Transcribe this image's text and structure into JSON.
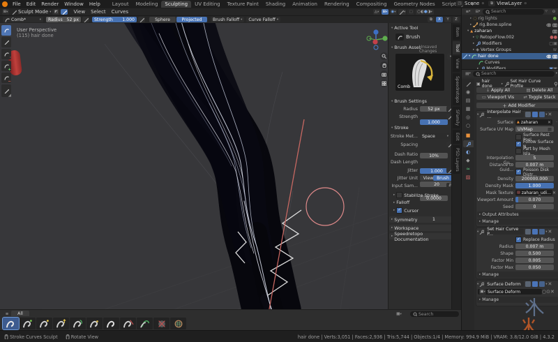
{
  "topbar": {
    "menus": [
      "File",
      "Edit",
      "Render",
      "Window",
      "Help"
    ],
    "workspaces": [
      "Layout",
      "Modeling",
      "Sculpting",
      "UV Editing",
      "Texture Paint",
      "Shading",
      "Animation",
      "Rendering",
      "Compositing",
      "Geometry Nodes",
      "Scripting"
    ],
    "active_workspace": "Sculpting",
    "new_workspace": "+",
    "scene": "Scene",
    "viewlayer": "ViewLayer"
  },
  "viewport_header": {
    "mode": "Sculpt Mode",
    "menus": [
      "View",
      "Select",
      "Curves"
    ]
  },
  "brush_header": {
    "brush": "Comb*",
    "radius_label": "Radius",
    "radius": "52 px",
    "strength_label": "Strength",
    "strength": "1.000",
    "sphere": "Sphere",
    "projected": "Projected",
    "brush_falloff": "Brush Falloff",
    "curve_falloff": "Curve Falloff",
    "mirror": [
      "X",
      "Y",
      "Z"
    ]
  },
  "viewport": {
    "overlay_line1": "User Perspective",
    "overlay_line2": "(115) hair done"
  },
  "npanel": {
    "tabs": [
      "Item",
      "Tool",
      "View",
      "Speedretopo",
      "SFamily",
      "Edit",
      "PSD Layers"
    ],
    "active_tab": "Tool",
    "active_tool_header": "Active Tool",
    "brush_name": "Brush",
    "brush_asset_header": "Brush Asset",
    "brush_asset_status": "Unsaved Changes",
    "preview_name": "Comb",
    "brush_settings_header": "Brush Settings",
    "radius_label": "Radius",
    "radius": "52 px",
    "strength_label": "Strength",
    "strength": "1.000",
    "stroke_header": "Stroke",
    "stroke_method_label": "Stroke Met...",
    "stroke_method": "Space",
    "spacing_label": "Spacing",
    "spacing": "10%",
    "dash_ratio_label": "Dash Ratio",
    "dash_ratio": "1.000",
    "dash_length_label": "Dash Length",
    "dash_length": "20",
    "jitter_label": "Jitter",
    "jitter": "0.0000",
    "jitter_unit_label": "Jitter Unit",
    "jitter_view": "View",
    "jitter_brush": "Brush",
    "input_samples_label": "Input Sam...",
    "input_samples": "1",
    "stabilize": "Stabilize Stroke",
    "falloff": "Falloff",
    "cursor": "Cursor",
    "sections": [
      "Symmetry",
      "Workspace",
      "Speedretopo Documentation"
    ]
  },
  "outliner": {
    "search_placeholder": "Search",
    "rows": [
      {
        "label": "rig lights"
      },
      {
        "label": "rig.Bone.spline"
      },
      {
        "label": "zaharan"
      },
      {
        "label": "RetopoFlow.002"
      },
      {
        "label": "Modifiers"
      },
      {
        "label": "Vertex Groups"
      },
      {
        "label": "hair done"
      },
      {
        "label": "Curves"
      },
      {
        "label": "Modifiers"
      }
    ]
  },
  "properties": {
    "search_placeholder": "Search",
    "breadcrumb_object": "hair done",
    "breadcrumb_modifier": "Set Hair Curve Profile",
    "tool_buttons": [
      "Apply All",
      "Delete All",
      "Viewport Vis",
      "Toggle Stack"
    ],
    "add_modifier": "Add Modifier",
    "mod1": {
      "title": "Interpolate Hair ...",
      "surface_label": "Surface",
      "surface": "zaharan",
      "uv_label": "Surface UV Map",
      "uv": "UVMap",
      "rest": "Surface Rest Posi...",
      "follow": "Follow Surface N...",
      "part": "Part by Mesh Isla...",
      "interp_label": "Interpolation Gu...",
      "interp": "5",
      "dist_label": "Distance to Guid...",
      "dist": "0.007 m",
      "poisson": "Poisson Disk Distr...",
      "density_label": "Density",
      "density": "200000.000",
      "dmask_label": "Density Mask",
      "dmask": "1.000",
      "mtex_label": "Mask Texture",
      "mtex": "zaharan_udi...",
      "vp_label": "Viewport Amount",
      "vp": "0.070",
      "seed_label": "Seed",
      "seed": "0",
      "sub1": "Output Attributes",
      "sub2": "Manage"
    },
    "mod2": {
      "title": "Set Hair Curve P...",
      "replace": "Replace Radius",
      "radius_label": "Radius",
      "radius": "0.007 m",
      "shape_label": "Shape",
      "shape": "0.500",
      "fmin_label": "Factor Min",
      "fmin": "0.005",
      "fmax_label": "Factor Max",
      "fmax": "0.050",
      "sub": "Manage"
    },
    "mod3": {
      "title": "Surface Deform",
      "target": "Surface Deform",
      "sub": "Manage"
    }
  },
  "asset_shelf": {
    "tab": "All",
    "search_placeholder": "Search"
  },
  "status": {
    "hint1": "Stroke Curves Sculpt",
    "hint2": "Rotate View",
    "stats": "hair done | Verts:3,051 | Faces:2,936 | Tris:5,744 | Objects:1/4 | Memory: 994.9 MiB | VRAM: 3.8/12.0 GiB | 4.3.2"
  },
  "watermark": {
    "char1": "氷",
    "char2": "火"
  },
  "colors": {
    "accent": "#4772b3",
    "selection": "#3a5f8f",
    "object_orange": "#e8913c",
    "curves_green": "#59c27a"
  }
}
